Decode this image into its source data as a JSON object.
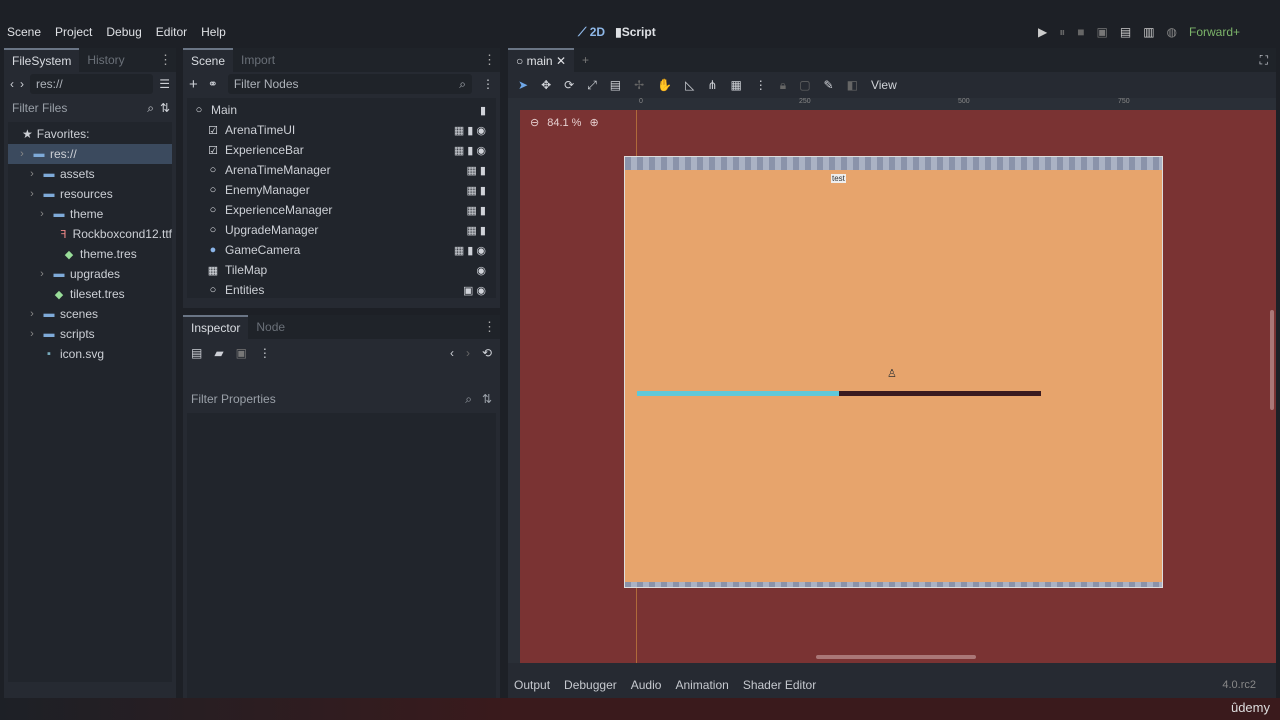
{
  "menu": [
    "Scene",
    "Project",
    "Debug",
    "Editor",
    "Help"
  ],
  "workspaces": {
    "two_d": "2D",
    "script": "Script"
  },
  "renderer": "Forward+",
  "filesystem": {
    "tabs": [
      "FileSystem",
      "History"
    ],
    "path": "res://",
    "filter_placeholder": "Filter Files",
    "favorites": "Favorites:",
    "items": [
      {
        "label": "res://",
        "depth": 0,
        "type": "folder"
      },
      {
        "label": "assets",
        "depth": 1,
        "type": "folder"
      },
      {
        "label": "resources",
        "depth": 1,
        "type": "folder"
      },
      {
        "label": "theme",
        "depth": 2,
        "type": "folder"
      },
      {
        "label": "Rockboxcond12.ttf",
        "depth": 3,
        "type": "font"
      },
      {
        "label": "theme.tres",
        "depth": 3,
        "type": "res"
      },
      {
        "label": "upgrades",
        "depth": 2,
        "type": "folder"
      },
      {
        "label": "tileset.tres",
        "depth": 2,
        "type": "res"
      },
      {
        "label": "scenes",
        "depth": 1,
        "type": "folder"
      },
      {
        "label": "scripts",
        "depth": 1,
        "type": "folder"
      },
      {
        "label": "icon.svg",
        "depth": 1,
        "type": "svg"
      }
    ]
  },
  "scene": {
    "tabs": [
      "Scene",
      "Import"
    ],
    "filter_placeholder": "Filter Nodes",
    "nodes": [
      {
        "label": "Main",
        "icon": "○",
        "right": "▮"
      },
      {
        "label": "ArenaTimeUI",
        "icon": "☑",
        "right": "▦ ▮ ◉"
      },
      {
        "label": "ExperienceBar",
        "icon": "☑",
        "right": "▦ ▮ ◉"
      },
      {
        "label": "ArenaTimeManager",
        "icon": "○",
        "right": "▦ ▮"
      },
      {
        "label": "EnemyManager",
        "icon": "○",
        "right": "▦ ▮"
      },
      {
        "label": "ExperienceManager",
        "icon": "○",
        "right": "▦ ▮"
      },
      {
        "label": "UpgradeManager",
        "icon": "○",
        "right": "▦ ▮"
      },
      {
        "label": "GameCamera",
        "icon": "●",
        "right": "▦ ▮ ◉"
      },
      {
        "label": "TileMap",
        "icon": "▦",
        "right": "◉"
      },
      {
        "label": "Entities",
        "icon": "○",
        "right": "▣ ◉"
      }
    ]
  },
  "inspector": {
    "tabs": [
      "Inspector",
      "Node"
    ],
    "filter_placeholder": "Filter Properties"
  },
  "viewport": {
    "tab": "main",
    "view_menu": "View",
    "zoom": "84.1 %",
    "ruler_labels": [
      "0",
      "250",
      "500",
      "750"
    ],
    "label_text": "test",
    "experience_progress": 0.5
  },
  "bottom": {
    "tabs": [
      "Output",
      "Debugger",
      "Audio",
      "Animation",
      "Shader Editor"
    ],
    "version": "4.0.rc2"
  },
  "watermark": "ûdemy"
}
